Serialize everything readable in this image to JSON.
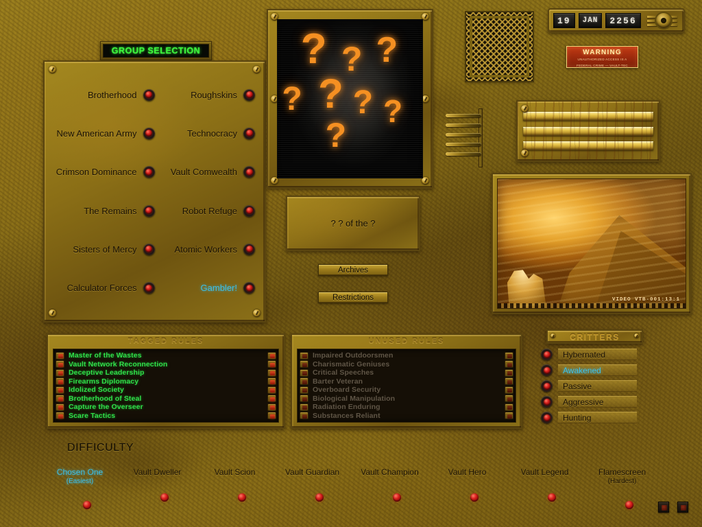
{
  "header": {
    "group_selection_title": "GROUP SELECTION"
  },
  "date_display": {
    "day": "19",
    "month": "JAN",
    "year": "2256"
  },
  "warning": {
    "title": "WARNING",
    "line1": "UNAUTHORIZED ACCESS IS A",
    "line2": "FEDERAL CRIME — VAULT-TEC"
  },
  "groups": {
    "items": [
      {
        "label": "Brotherhood",
        "side": "left",
        "highlighted": false
      },
      {
        "label": "Roughskins",
        "side": "right",
        "highlighted": false
      },
      {
        "label": "New American Army",
        "side": "left",
        "highlighted": false
      },
      {
        "label": "Technocracy",
        "side": "right",
        "highlighted": false
      },
      {
        "label": "Crimson Dominance",
        "side": "left",
        "highlighted": false
      },
      {
        "label": "Vault Comwealth",
        "side": "right",
        "highlighted": false
      },
      {
        "label": "The Remains",
        "side": "left",
        "highlighted": false
      },
      {
        "label": "Robot Refuge",
        "side": "right",
        "highlighted": false
      },
      {
        "label": "Sisters of Mercy",
        "side": "left",
        "highlighted": false
      },
      {
        "label": "Atomic Workers",
        "side": "right",
        "highlighted": false
      },
      {
        "label": "Calculator Forces",
        "side": "left",
        "highlighted": false
      },
      {
        "label": "Gambler!",
        "side": "right",
        "highlighted": true
      }
    ]
  },
  "portrait": {
    "unknown_marks": [
      "?",
      "?",
      "?",
      "?",
      "?",
      "?",
      "?",
      "?"
    ]
  },
  "nameplate": {
    "text": "? ? of the ?"
  },
  "buttons": {
    "archives": "Archives",
    "restrictions": "Restrictions"
  },
  "video": {
    "label": "VIDEO VTB-001:13:1"
  },
  "tagged_rules": {
    "title": "TAGGED RULES",
    "items": [
      "Master of the Wastes",
      "Vault Network Reconnection",
      "Deceptive Leadership",
      "Firearms Diplomacy",
      "Idolized Society",
      "Brotherhood of Steal",
      "Capture the Overseer",
      "Scare Tactics"
    ]
  },
  "unused_rules": {
    "title": "UNUSED RULES",
    "items": [
      "Impaired Outdoorsmen",
      "Charismatic Geniuses",
      "Critical Speeches",
      "Barter Veteran",
      "Overboard Security",
      "Biological Manipulation",
      "Radiation Enduring",
      "Substances Reliant"
    ]
  },
  "critters": {
    "title": "CRITTERS",
    "items": [
      {
        "label": "Hybernated",
        "highlighted": false
      },
      {
        "label": "Awakened",
        "highlighted": true
      },
      {
        "label": "Passive",
        "highlighted": false
      },
      {
        "label": "Aggressive",
        "highlighted": false
      },
      {
        "label": "Hunting",
        "highlighted": false
      }
    ]
  },
  "difficulty": {
    "label": "DIFFICULTY",
    "items": [
      {
        "name": "Chosen One",
        "sub": "(Easiest)",
        "highlighted": true
      },
      {
        "name": "Vault Dweller",
        "sub": "",
        "highlighted": false
      },
      {
        "name": "Vault Scion",
        "sub": "",
        "highlighted": false
      },
      {
        "name": "Vault Guardian",
        "sub": "",
        "highlighted": false
      },
      {
        "name": "Vault Champion",
        "sub": "",
        "highlighted": false
      },
      {
        "name": "Vault Hero",
        "sub": "",
        "highlighted": false
      },
      {
        "name": "Vault Legend",
        "sub": "",
        "highlighted": false
      },
      {
        "name": "Flamescreen",
        "sub": "(Hardest)",
        "highlighted": false
      }
    ]
  },
  "colors": {
    "highlight": "#3bbfe8",
    "tagged_green": "#2fe04a",
    "header_green": "#3dfa3d",
    "warning_red": "#c23a14",
    "led_red": "#d8201c"
  }
}
